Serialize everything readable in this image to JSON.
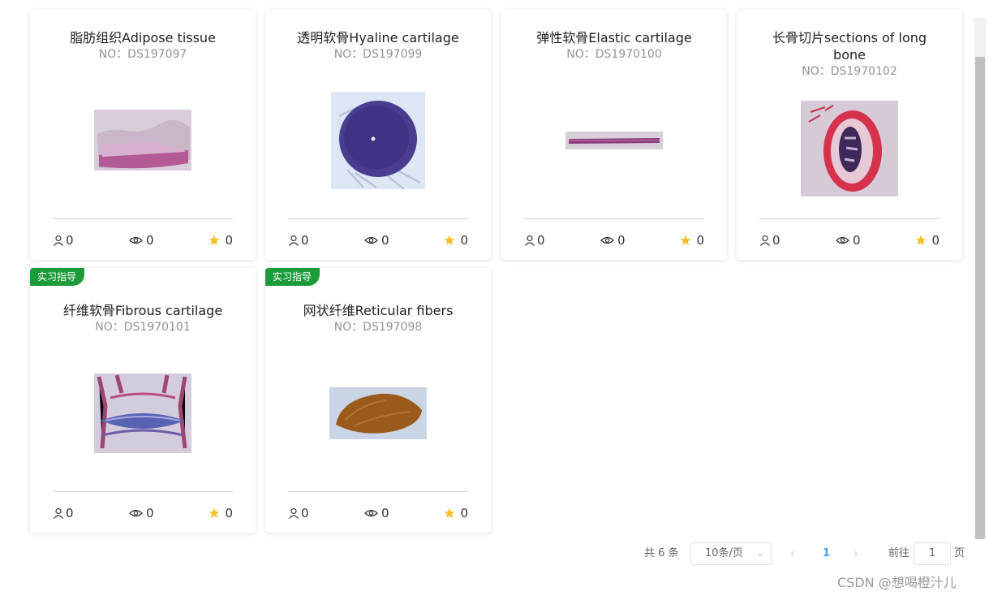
{
  "cards": [
    {
      "title": "脂肪组织Adipose tissue",
      "no": "NO：DS197097",
      "authors": "0",
      "views": "0",
      "stars": "0"
    },
    {
      "title": "透明软骨Hyaline cartilage",
      "no": "NO：DS197099",
      "authors": "0",
      "views": "0",
      "stars": "0"
    },
    {
      "title": "弹性软骨Elastic cartilage",
      "no": "NO：DS1970100",
      "authors": "0",
      "views": "0",
      "stars": "0"
    },
    {
      "title_line1": "长骨切片sections of long",
      "title_line2": "bone",
      "no": "NO：DS1970102",
      "authors": "0",
      "views": "0",
      "stars": "0"
    },
    {
      "badge": "实习指导",
      "title": "纤维软骨Fibrous cartilage",
      "no": "NO：DS1970101",
      "authors": "0",
      "views": "0",
      "stars": "0"
    },
    {
      "badge": "实习指导",
      "title": "网状纤维Reticular fibers",
      "no": "NO：DS197098",
      "authors": "0",
      "views": "0",
      "stars": "0"
    }
  ],
  "pagination": {
    "total": "共 6 条",
    "page_size": "10条/页",
    "prev": "‹",
    "current_page": "1",
    "next": "›",
    "goto_label": "前往",
    "goto_value": "1",
    "goto_unit": "页"
  },
  "watermark": "CSDN @想喝橙汁儿",
  "colors": {
    "badge": "#1b9b3a",
    "star": "#f5c02a",
    "active_page": "#409eff"
  }
}
